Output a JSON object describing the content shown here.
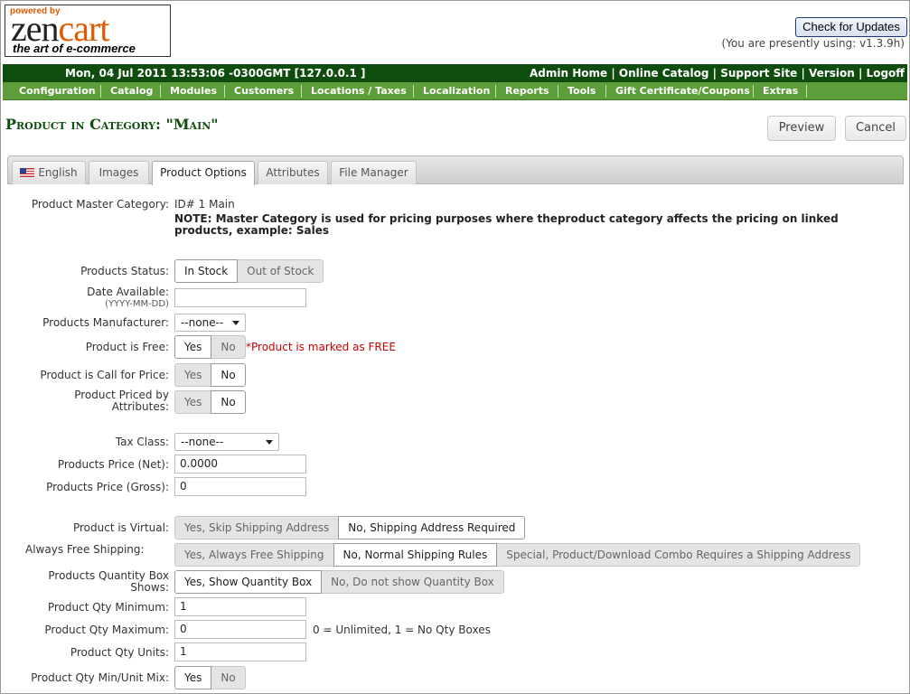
{
  "header": {
    "logo_powered": "powered by",
    "logo_zen": "zen",
    "logo_cart": "cart",
    "logo_tagline": "the art of e-commerce",
    "check_updates": "Check for Updates",
    "version_note": "(You are presently using: v1.3.9h)"
  },
  "topbar": {
    "datetime": "Mon, 04 Jul 2011 13:53:06 -0300GMT [127.0.0.1 ]",
    "links": [
      "Admin Home",
      "Online Catalog",
      "Support Site",
      "Version",
      "Logoff"
    ],
    "separator": "|"
  },
  "menu": [
    "Configuration",
    "Catalog",
    "Modules",
    "Customers",
    "Locations / Taxes",
    "Localization",
    "Reports",
    "Tools",
    "Gift Certificate/Coupons",
    "Extras"
  ],
  "page": {
    "title": "Product in Category: \"Main\"",
    "preview": "Preview",
    "cancel": "Cancel"
  },
  "tabs": [
    "English",
    "Images",
    "Product Options",
    "Attributes",
    "File Manager"
  ],
  "form": {
    "master_category_label": "Product Master Category:",
    "master_category_value": "ID# 1 Main",
    "master_category_note": "NOTE: Master Category is used for pricing purposes where theproduct category affects the pricing on linked products, example: Sales",
    "status_label": "Products Status:",
    "status_options": [
      "In Stock",
      "Out of Stock"
    ],
    "date_label": "Date Available:",
    "date_hint": "(YYYY-MM-DD)",
    "date_value": "",
    "manufacturer_label": "Products Manufacturer:",
    "manufacturer_value": "--none--",
    "free_label": "Product is Free:",
    "free_options": [
      "Yes",
      "No"
    ],
    "free_note": "*Product is marked as FREE",
    "call_label": "Product is Call for Price:",
    "call_options": [
      "Yes",
      "No"
    ],
    "priced_attr_label_1": "Product Priced by",
    "priced_attr_label_2": "Attributes:",
    "priced_attr_options": [
      "Yes",
      "No"
    ],
    "tax_label": "Tax Class:",
    "tax_value": "--none--",
    "price_net_label": "Products Price (Net):",
    "price_net_value": "0.0000",
    "price_gross_label": "Products Price (Gross):",
    "price_gross_value": "0",
    "virtual_label": "Product is Virtual:",
    "virtual_options": [
      "Yes, Skip Shipping Address",
      "No, Shipping Address Required"
    ],
    "free_ship_label": "Always Free Shipping:",
    "free_ship_options": [
      "Yes, Always Free Shipping",
      "No, Normal Shipping Rules",
      "Special, Product/Download Combo Requires a Shipping Address"
    ],
    "qty_box_label_1": "Products Quantity Box",
    "qty_box_label_2": "Shows:",
    "qty_box_options": [
      "Yes, Show Quantity Box",
      "No, Do not show Quantity Box"
    ],
    "qty_min_label": "Product Qty Minimum:",
    "qty_min_value": "1",
    "qty_max_label": "Product Qty Maximum:",
    "qty_max_value": "0",
    "qty_max_note": "0 = Unlimited, 1 = No Qty Boxes",
    "qty_units_label": "Product Qty Units:",
    "qty_units_value": "1",
    "qty_mix_label": "Product Qty Min/Unit Mix:",
    "qty_mix_options": [
      "Yes",
      "No"
    ]
  },
  "colors": {
    "topbar": "#0e4d0e",
    "menubar": "#5e9e3a",
    "title": "#0e4d0e",
    "free_note": "#cc0000",
    "logo_accent": "#e05a00"
  }
}
